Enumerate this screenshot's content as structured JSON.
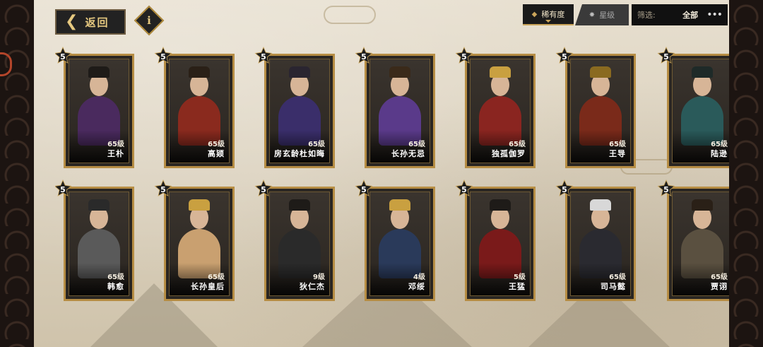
{
  "nav": {
    "back_label": "返回",
    "info_label": "i"
  },
  "sort": {
    "tabs": [
      {
        "label": "稀有度",
        "active": true
      },
      {
        "label": "星级",
        "active": false
      }
    ]
  },
  "filter": {
    "label": "筛选:",
    "value": "全部"
  },
  "cards": [
    {
      "stars": "5",
      "level": "65级",
      "name": "王朴",
      "robe": "#4a2a5e"
    },
    {
      "stars": "5",
      "level": "65级",
      "name": "高颎",
      "robe": "#8a2a1e"
    },
    {
      "stars": "5",
      "level": "65级",
      "name": "房玄龄杜如晦",
      "robe": "#3a2e6a"
    },
    {
      "stars": "5",
      "level": "65级",
      "name": "长孙无忌",
      "robe": "#5a3a8a"
    },
    {
      "stars": "5",
      "level": "65级",
      "name": "独孤伽罗",
      "robe": "#8a2520"
    },
    {
      "stars": "5",
      "level": "65级",
      "name": "王导",
      "robe": "#7a2a1a"
    },
    {
      "stars": "5",
      "level": "65级",
      "name": "陆逊",
      "robe": "#2a5a5a"
    },
    {
      "stars": "5",
      "level": "65级",
      "name": "韩愈",
      "robe": "#5a5a5a"
    },
    {
      "stars": "5",
      "level": "65级",
      "name": "长孙皇后",
      "robe": "#c9a070"
    },
    {
      "stars": "5",
      "level": "9级",
      "name": "狄仁杰",
      "robe": "#2a2a2a"
    },
    {
      "stars": "5",
      "level": "4级",
      "name": "邓绥",
      "robe": "#2a3a5a"
    },
    {
      "stars": "5",
      "level": "5级",
      "name": "王猛",
      "robe": "#7a1a1a"
    },
    {
      "stars": "5",
      "level": "65级",
      "name": "司马懿",
      "robe": "#2a2a30"
    },
    {
      "stars": "5",
      "level": "65级",
      "name": "贾诩",
      "robe": "#5a5040"
    }
  ]
}
